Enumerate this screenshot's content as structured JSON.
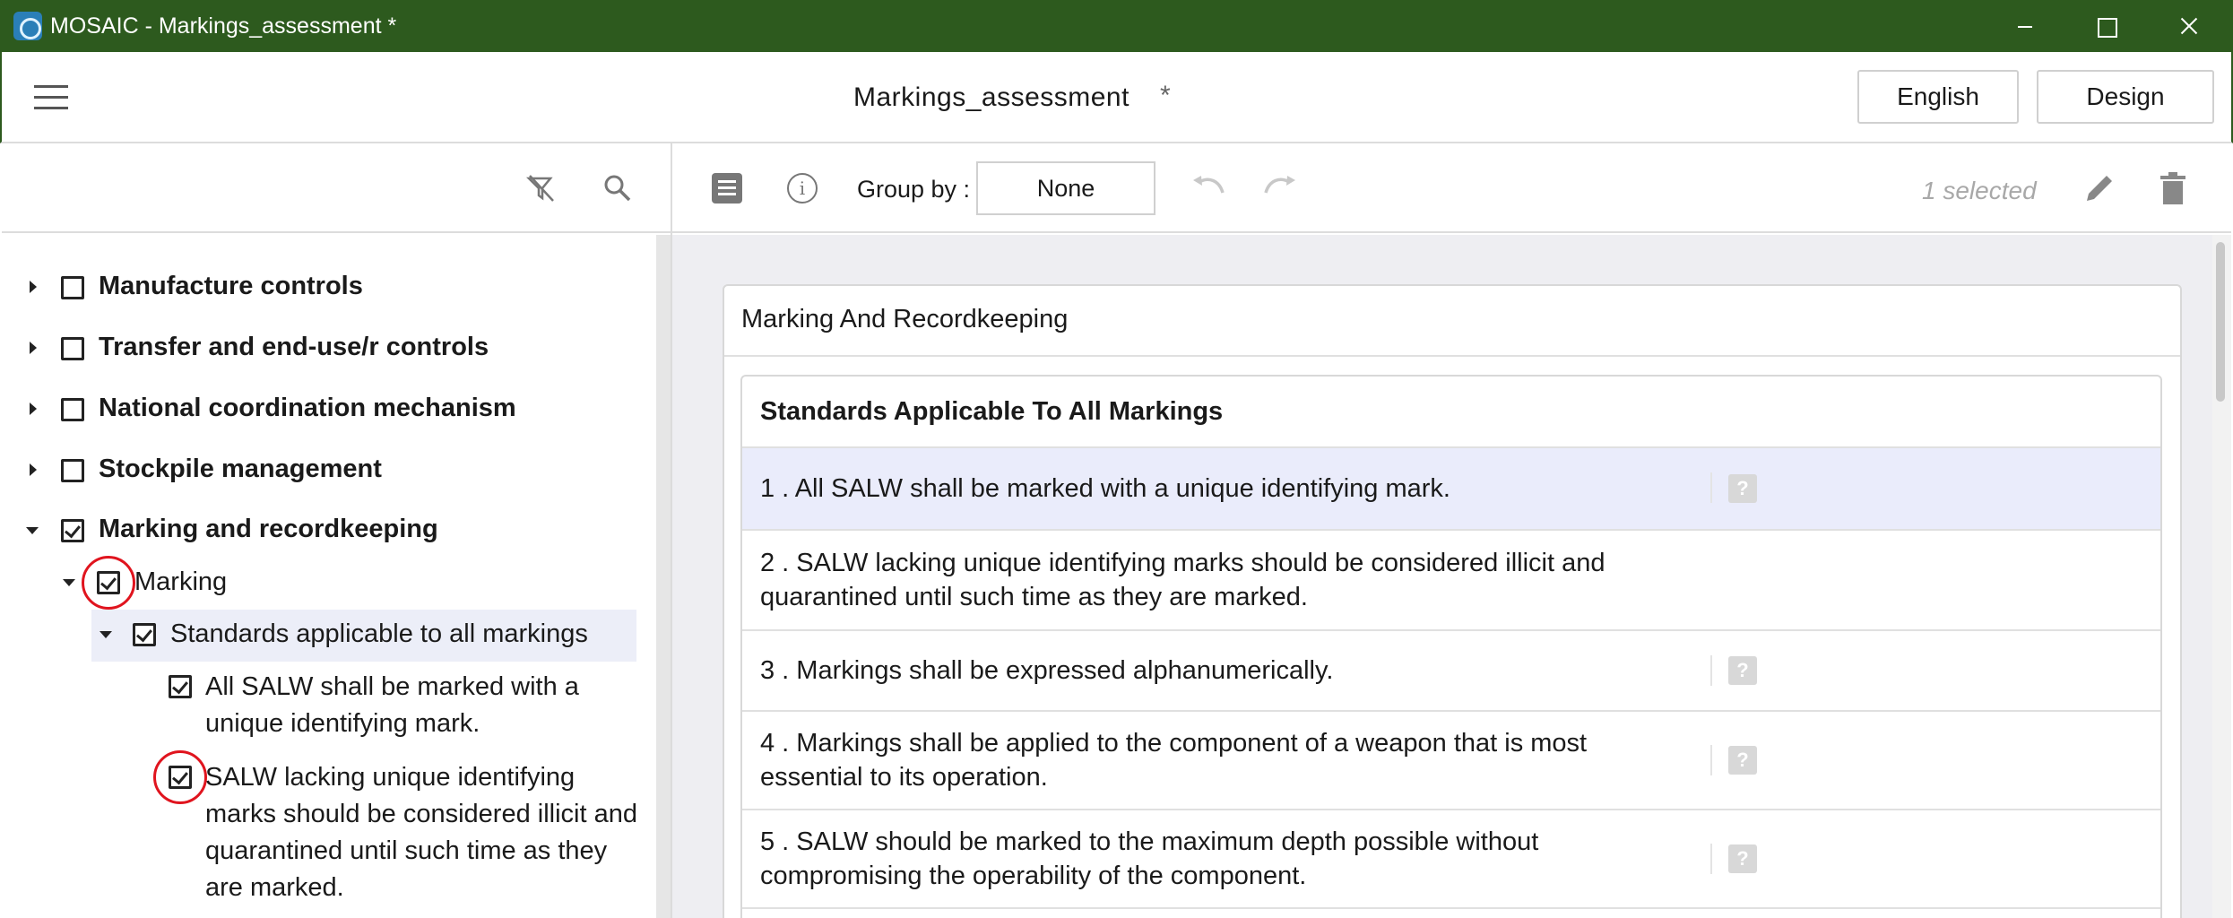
{
  "window": {
    "title": "MOSAIC - Markings_assessment *"
  },
  "header": {
    "doc_title": "Markings_assessment",
    "modified_marker": "*",
    "language_button": "English",
    "design_button": "Design"
  },
  "tree": {
    "items": [
      {
        "label": "Manufacture controls",
        "checked": false,
        "expanded": false
      },
      {
        "label": "Transfer and end-use/r controls",
        "checked": false,
        "expanded": false
      },
      {
        "label": "National coordination mechanism",
        "checked": false,
        "expanded": false
      },
      {
        "label": "Stockpile management",
        "checked": false,
        "expanded": false
      },
      {
        "label": "Marking and recordkeeping",
        "checked": true,
        "expanded": true
      },
      {
        "label": "Marking",
        "checked": true,
        "expanded": true
      },
      {
        "label": "Standards applicable to all markings",
        "checked": true,
        "expanded": true
      },
      {
        "label": "All SALW shall be marked with a unique identifying mark.",
        "checked": true
      },
      {
        "label": "SALW lacking unique identifying marks should be considered illicit and quarantined until such time as they are marked.",
        "checked": true
      }
    ]
  },
  "toolbar": {
    "group_by_label": "Group by :",
    "group_by_value": "None",
    "selected_count": "1 selected"
  },
  "content": {
    "section_title": "Marking And Recordkeeping",
    "subsection_title": "Standards Applicable To All Markings",
    "help_glyph": "?",
    "questions": [
      {
        "text": "1 .  All SALW shall be marked with a unique identifying mark.",
        "selected": true,
        "has_help": true
      },
      {
        "text": "2 .  SALW lacking unique identifying marks should be considered illicit and quarantined until such time as they are marked.",
        "selected": false,
        "has_help": false
      },
      {
        "text": "3 .  Markings shall be expressed alphanumerically.",
        "selected": false,
        "has_help": true
      },
      {
        "text": "4 .  Markings shall be applied to the component of a weapon that is most essential to its operation.",
        "selected": false,
        "has_help": true
      },
      {
        "text": "5 .  SALW should be marked to the maximum depth possible without compromising the operability of the component.",
        "selected": false,
        "has_help": true
      }
    ]
  },
  "colors": {
    "titlebar": "#2d5a1e",
    "selected_row": "#eaecfb",
    "annotation_circle": "#e0141e"
  }
}
